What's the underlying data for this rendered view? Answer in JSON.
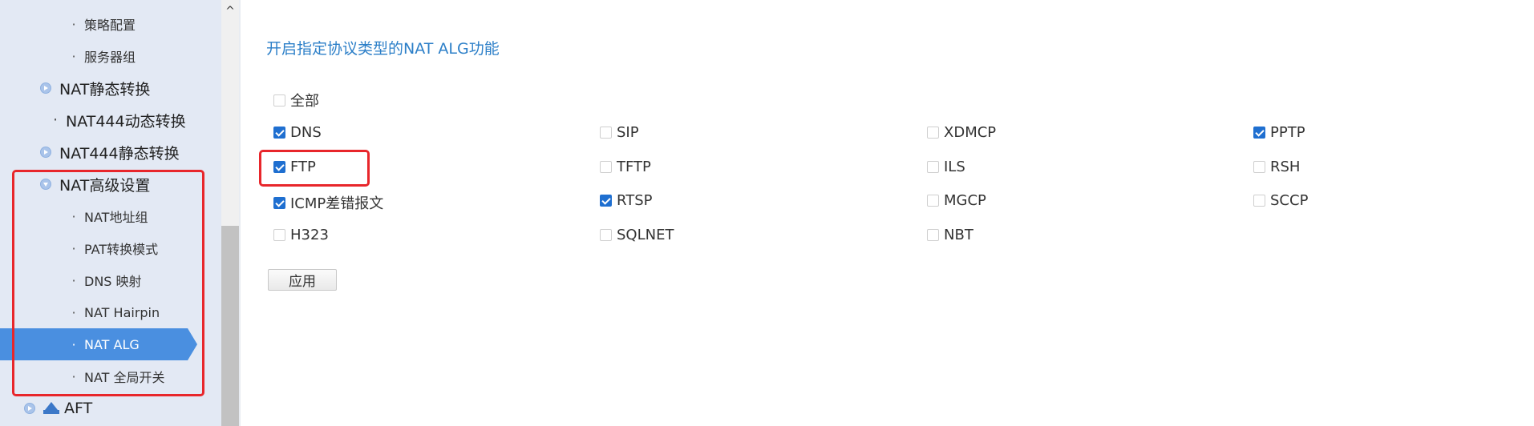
{
  "sidebar": {
    "items": [
      {
        "label": "策略配置"
      },
      {
        "label": "服务器组"
      },
      {
        "label": "NAT静态转换"
      },
      {
        "label": "NAT444动态转换"
      },
      {
        "label": "NAT444静态转换"
      },
      {
        "label": "NAT高级设置"
      },
      {
        "label": "NAT地址组"
      },
      {
        "label": "PAT转换模式"
      },
      {
        "label": "DNS 映射"
      },
      {
        "label": "NAT Hairpin"
      },
      {
        "label": "NAT ALG"
      },
      {
        "label": "NAT 全局开关"
      },
      {
        "label": "AFT"
      }
    ],
    "bullet": "·",
    "active_label": "NAT ALG"
  },
  "scrollbar": {
    "up_arrow": "^"
  },
  "main": {
    "title": "开启指定协议类型的NAT ALG功能",
    "all_option": {
      "label": "全部",
      "checked": false
    },
    "options": [
      {
        "label": "DNS",
        "checked": true
      },
      {
        "label": "SIP",
        "checked": false
      },
      {
        "label": "XDMCP",
        "checked": false
      },
      {
        "label": "PPTP",
        "checked": true
      },
      {
        "label": "FTP",
        "checked": true
      },
      {
        "label": "TFTP",
        "checked": false
      },
      {
        "label": "ILS",
        "checked": false
      },
      {
        "label": "RSH",
        "checked": false
      },
      {
        "label": "ICMP差错报文",
        "checked": true
      },
      {
        "label": "RTSP",
        "checked": true
      },
      {
        "label": "MGCP",
        "checked": false
      },
      {
        "label": "SCCP",
        "checked": false
      },
      {
        "label": "H323",
        "checked": false
      },
      {
        "label": "SQLNET",
        "checked": false
      },
      {
        "label": "NBT",
        "checked": false
      }
    ],
    "apply_label": "应用"
  },
  "colors": {
    "sidebar_bg": "#e3e9f4",
    "active_bg": "#4a8fe0",
    "title": "#2c7fc8",
    "checkbox_checked": "#1f6fd0",
    "highlight": "#e8262b"
  }
}
